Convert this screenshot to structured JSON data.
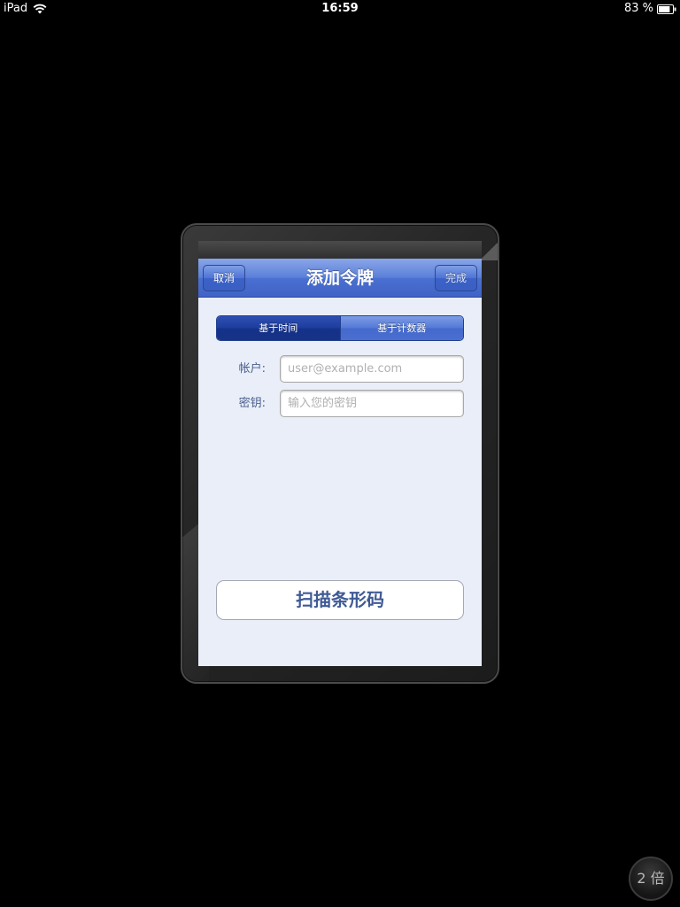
{
  "status_bar": {
    "device": "iPad",
    "time": "16:59",
    "battery_percent": "83 %",
    "battery_level": 0.83,
    "wifi_icon": "wifi-icon",
    "battery_icon": "battery-icon"
  },
  "app": {
    "navbar": {
      "title": "添加令牌",
      "cancel_label": "取消",
      "done_label": "完成"
    },
    "segmented": {
      "options": [
        "基于时间",
        "基于计数器"
      ],
      "selected": "基于时间"
    },
    "form": {
      "account": {
        "label": "帐户:",
        "value": "",
        "placeholder": "user@example.com"
      },
      "secret": {
        "label": "密钥:",
        "value": "",
        "placeholder": "输入您的密钥"
      }
    },
    "scan_button_label": "扫描条形码"
  },
  "zoom_button": {
    "label": "2 倍"
  },
  "colors": {
    "navbar_accent": "#4a70d2",
    "segment_selected": "#1d3d9e",
    "app_background": "#e9eef8",
    "label_text": "#4a5f8f"
  }
}
